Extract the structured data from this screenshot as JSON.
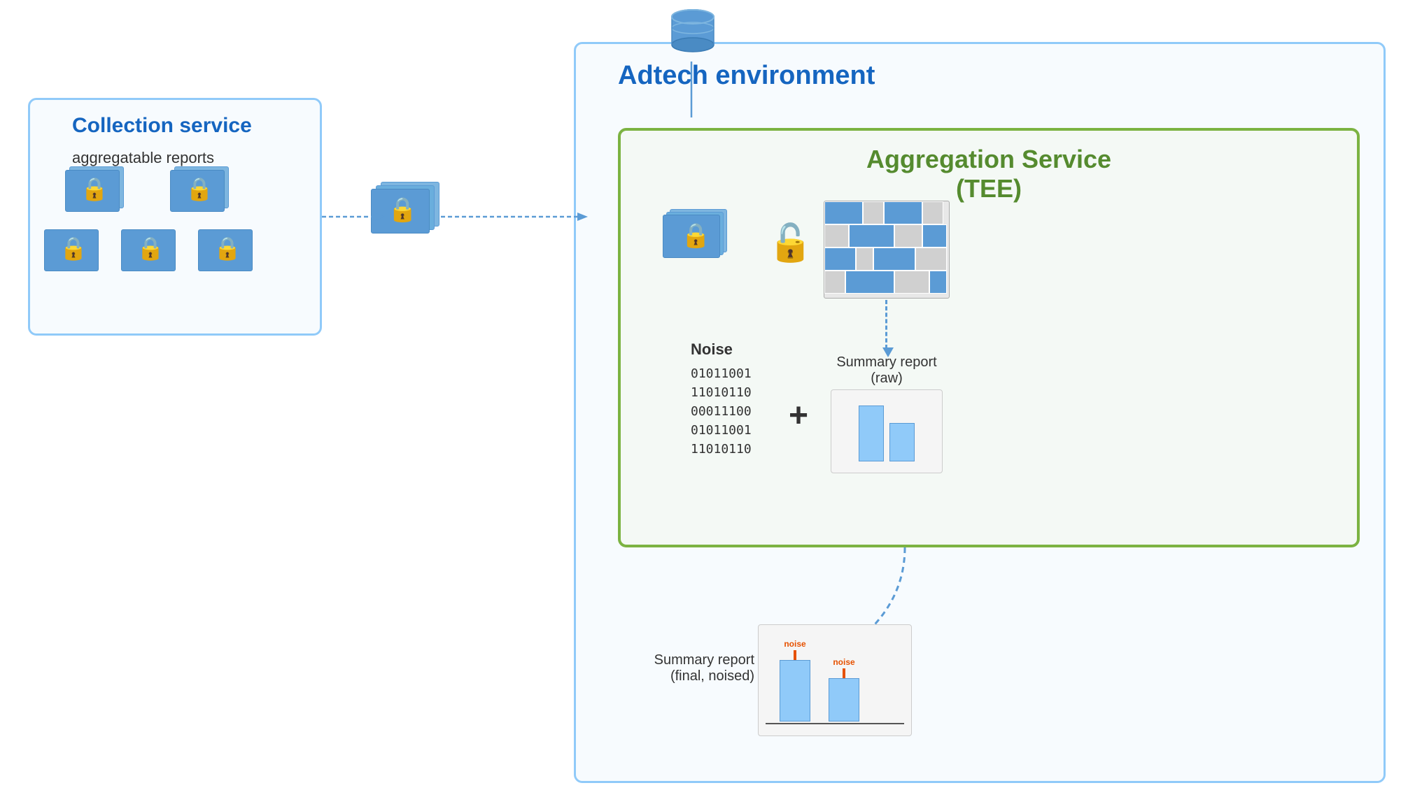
{
  "adtech": {
    "label": "Adtech environment"
  },
  "collection": {
    "label": "Collection service",
    "sublabel": "aggregatable reports"
  },
  "aggregation": {
    "label": "Aggregation Service",
    "label2": "(TEE)"
  },
  "noise": {
    "title": "Noise",
    "lines": [
      "01011001",
      "11010110",
      "00011100",
      "01011001",
      "11010110"
    ]
  },
  "summary_raw": {
    "label": "Summary report",
    "sublabel": "(raw)"
  },
  "summary_final": {
    "label": "Summary report",
    "sublabel": "(final, noised)"
  },
  "noise_labels": {
    "n1": "noise",
    "n2": "noise"
  },
  "colors": {
    "blue_border": "#90CAF9",
    "green_border": "#7CB342",
    "blue_label": "#1565C0",
    "green_label": "#558B2F",
    "doc_blue": "#5B9BD5",
    "doc_light": "#7EB6E0",
    "lock_color": "#F9A825",
    "arrow_blue": "#5B9BD5"
  }
}
